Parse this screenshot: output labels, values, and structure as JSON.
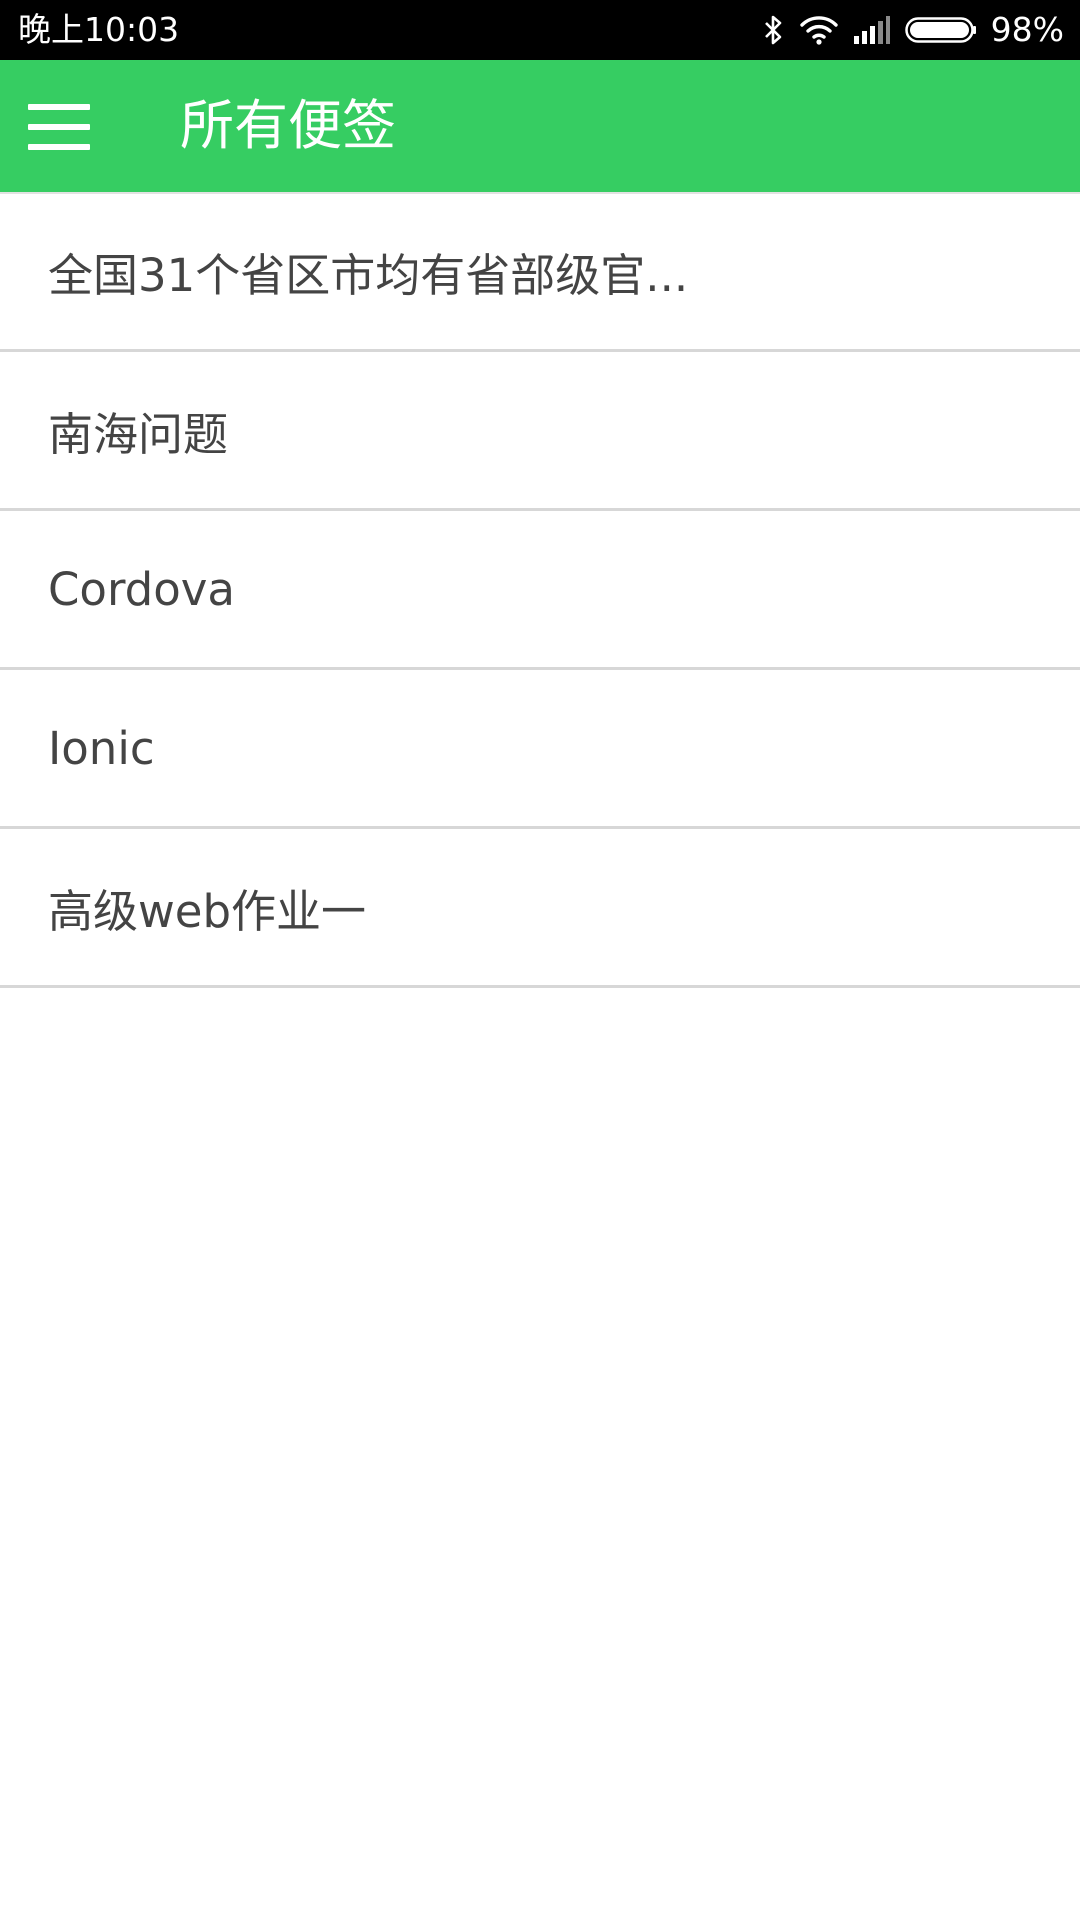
{
  "status_bar": {
    "time": "晚上10:03",
    "battery_percent": "98%",
    "icons": [
      "bluetooth-icon",
      "wifi-icon",
      "signal-icon",
      "battery-icon"
    ],
    "battery_level": 0.98
  },
  "app_bar": {
    "menu_icon": "menu-icon",
    "title": "所有便签",
    "color": "#36cd62"
  },
  "notes": [
    {
      "title": "全国31个省区市均有省部级官..."
    },
    {
      "title": "南海问题"
    },
    {
      "title": "Cordova"
    },
    {
      "title": "Ionic"
    },
    {
      "title": "高级web作业一"
    }
  ]
}
